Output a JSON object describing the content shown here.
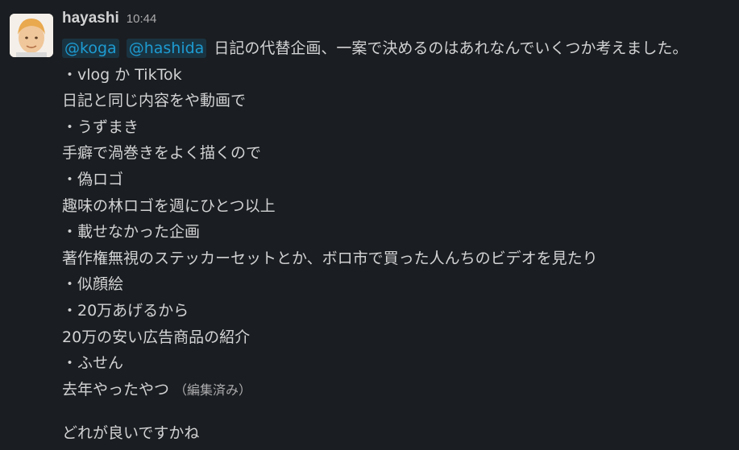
{
  "message": {
    "username": "hayashi",
    "timestamp": "10:44",
    "mentions": [
      "@koga",
      "@hashida"
    ],
    "first_line_text": "日記の代替企画、一案で決めるのはあれなんでいくつか考えました。",
    "lines": [
      "・vlog か TikTok",
      "日記と同じ内容をや動画で",
      "・うずまき",
      "手癖で渦巻きをよく描くので",
      "・偽ロゴ",
      "趣味の林ロゴを週にひとつ以上",
      "・載せなかった企画",
      "著作権無視のステッカーセットとか、ボロ市で買った人んちのビデオを見たり",
      "・似顔絵",
      "・20万あげるから",
      "20万の安い広告商品の紹介",
      "・ふせん"
    ],
    "last_line_text": "去年やったやつ",
    "edited_label": "（編集済み）",
    "closing_line": "どれが良いですかね"
  },
  "colors": {
    "background": "#1a1d21",
    "text": "#d1d2d3",
    "muted": "#ababad",
    "mention": "#1d9bd1"
  }
}
